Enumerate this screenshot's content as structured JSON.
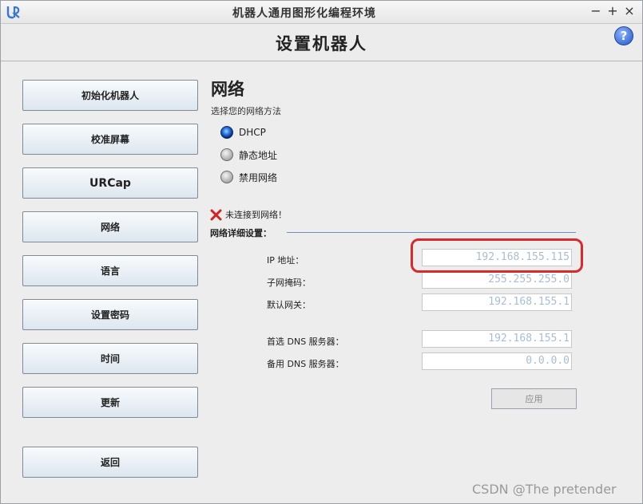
{
  "window": {
    "title": "机器人通用图形化编程环境",
    "controls": [
      "−",
      "+",
      "×"
    ]
  },
  "header": {
    "title": "设置机器人",
    "help": "?"
  },
  "sidebar": {
    "items": [
      {
        "label": "初始化机器人"
      },
      {
        "label": "校准屏幕"
      },
      {
        "label": "URCap"
      },
      {
        "label": "网络"
      },
      {
        "label": "语言"
      },
      {
        "label": "设置密码"
      },
      {
        "label": "时间"
      },
      {
        "label": "更新"
      },
      {
        "label": "返回"
      }
    ]
  },
  "network": {
    "title": "网络",
    "subtitle": "选择您的网络方法",
    "options": [
      {
        "label": "DHCP",
        "checked": true
      },
      {
        "label": "静态地址",
        "checked": false
      },
      {
        "label": "禁用网络",
        "checked": false
      }
    ],
    "status": "未连接到网络！",
    "details_label": "网络详细设置：",
    "fields": {
      "ip": {
        "label": "IP 地址：",
        "value": "192.168.155.115"
      },
      "subnet": {
        "label": "子网掩码：",
        "value": "255.255.255.0"
      },
      "gateway": {
        "label": "默认网关：",
        "value": "192.168.155.1"
      },
      "dns1": {
        "label": "首选 DNS 服务器：",
        "value": "192.168.155.1"
      },
      "dns2": {
        "label": "备用 DNS 服务器：",
        "value": "0.0.0.0"
      }
    },
    "apply_label": "应用"
  },
  "watermark": "CSDN @The  pretender",
  "colors": {
    "highlight": "#d82a2a",
    "field_text": "#a8bdd3",
    "status_icon": "#d62020"
  }
}
